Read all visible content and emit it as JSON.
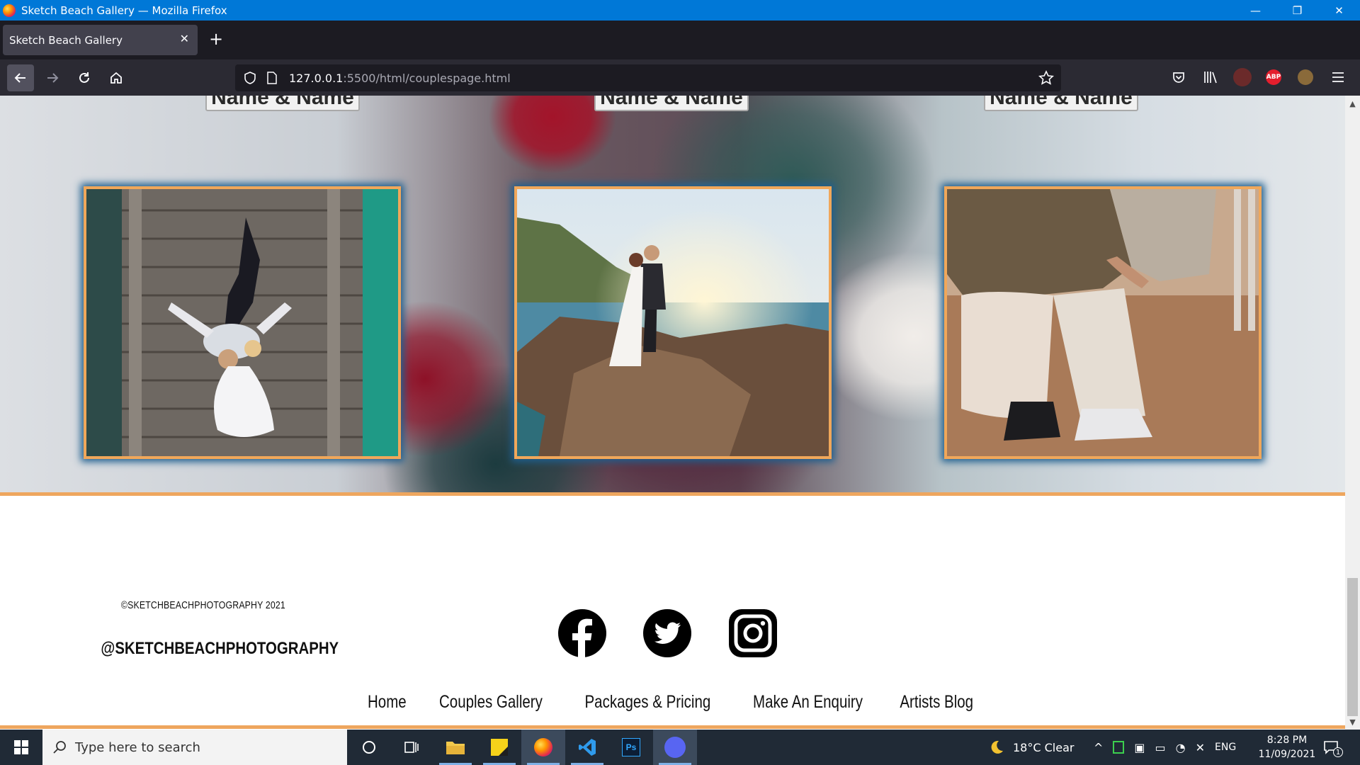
{
  "window": {
    "title": "Sketch Beach Gallery — Mozilla Firefox",
    "controls": [
      "—",
      "❐",
      "✕"
    ]
  },
  "tabs": [
    {
      "label": "Sketch Beach Gallery",
      "close": "✕"
    }
  ],
  "new_tab_label": "+",
  "urlbar": {
    "host": "127.0.0.1",
    "path": ":5500/html/couplespage.html"
  },
  "extensions": {
    "abp_label": "ABP"
  },
  "hero": {
    "name_chips": [
      "Name & Name",
      "Name & Name",
      "Name & Name"
    ]
  },
  "footer": {
    "copyright": "©SKETCHBEACHPHOTOGRAPHY 2021",
    "handle": "@SKETCHBEACHPHOTOGRAPHY",
    "social": [
      "facebook-icon",
      "twitter-icon",
      "instagram-icon"
    ],
    "nav": [
      "Home",
      "Couples Gallery",
      "Packages & Pricing",
      "Make An Enquiry",
      "Artists Blog"
    ]
  },
  "colors": {
    "accent_orange": "#eea65e",
    "photo_glow": "#1f5f8f",
    "titlebar": "#0078d7"
  },
  "taskbar": {
    "search_placeholder": "Type here to search",
    "weather": "18°C  Clear",
    "language": "ENG",
    "time": "8:28 PM",
    "date": "11/09/2021",
    "notification_count": "1",
    "apps": [
      "cortana",
      "task-view",
      "file-explorer",
      "sticky-notes",
      "firefox",
      "vscode",
      "photoshop",
      "discord"
    ]
  }
}
